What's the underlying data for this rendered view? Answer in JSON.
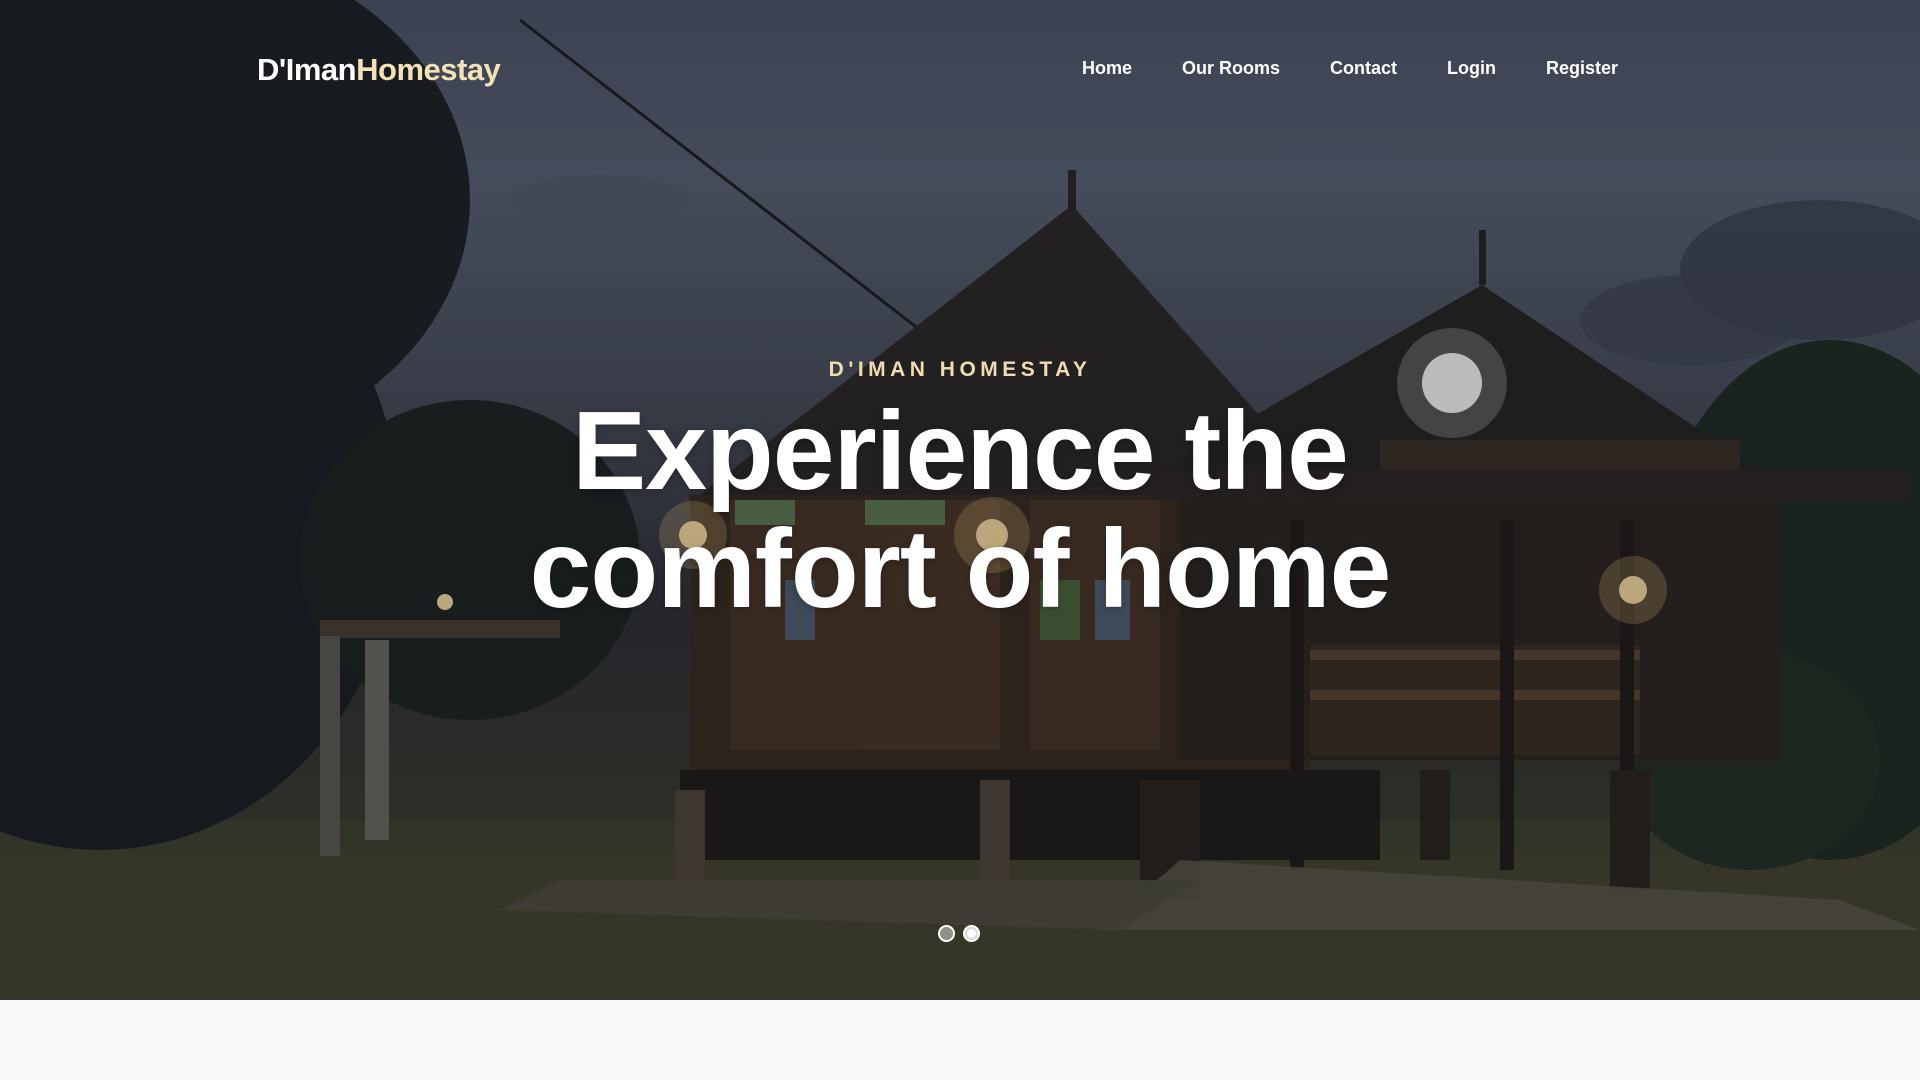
{
  "brand": {
    "part1": "D'Iman",
    "part2": "Homestay"
  },
  "nav": {
    "items": [
      {
        "label": "Home"
      },
      {
        "label": "Our Rooms"
      },
      {
        "label": "Contact"
      },
      {
        "label": "Login"
      },
      {
        "label": "Register"
      }
    ]
  },
  "hero": {
    "eyebrow": "D'IMAN HOMESTAY",
    "headline_line1": "Experience the",
    "headline_line2": "comfort of home",
    "slides_total": 2,
    "active_slide": 2
  },
  "colors": {
    "accent": "#f3e2b6",
    "text": "#ffffff",
    "below_background": "#f7f8fa"
  },
  "icons": {
    "background_image": "wooden-house-night-photo"
  }
}
